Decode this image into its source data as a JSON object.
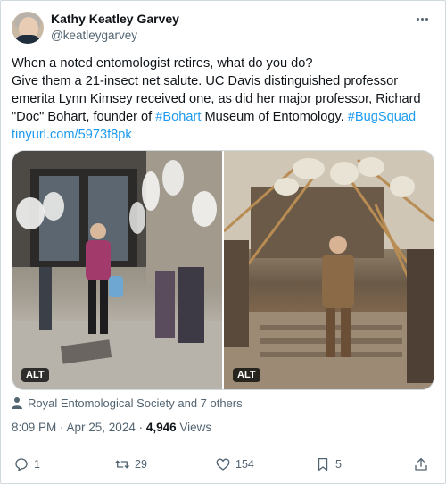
{
  "author": {
    "name": "Kathy Keatley Garvey",
    "handle": "@keatleygarvey"
  },
  "tweet": {
    "line1": "When a noted entomologist retires, what do you do?",
    "line2": "Give them a 21-insect net salute. UC Davis distinguished professor",
    "line3": "emerita Lynn Kimsey received one, as did her major professor, Richard",
    "line4_text": "\"Doc\" Bohart, founder of ",
    "hashtag1": "#Bohart",
    "line4_mid": " Museum of Entomology. ",
    "hashtag2": "#BugSquad",
    "url": "tinyurl.com/5973f8pk"
  },
  "media": {
    "left_alt": "ALT",
    "right_alt": "ALT"
  },
  "liked_by": "Royal Entomological Society and 7 others",
  "meta": {
    "time_date": "8:09 PM · Apr 25, 2024 · ",
    "views_count": "4,946",
    "views_label": " Views"
  },
  "actions": {
    "replies": "1",
    "reposts": "29",
    "likes": "154",
    "bookmarks": "5"
  },
  "colors": {
    "accent": "#1d9bf0",
    "secondary_text": "#536471",
    "primary_text": "#0f1419"
  },
  "icons": [
    "more-icon",
    "person-icon",
    "reply-icon",
    "repost-icon",
    "like-icon",
    "bookmark-icon",
    "share-icon"
  ]
}
